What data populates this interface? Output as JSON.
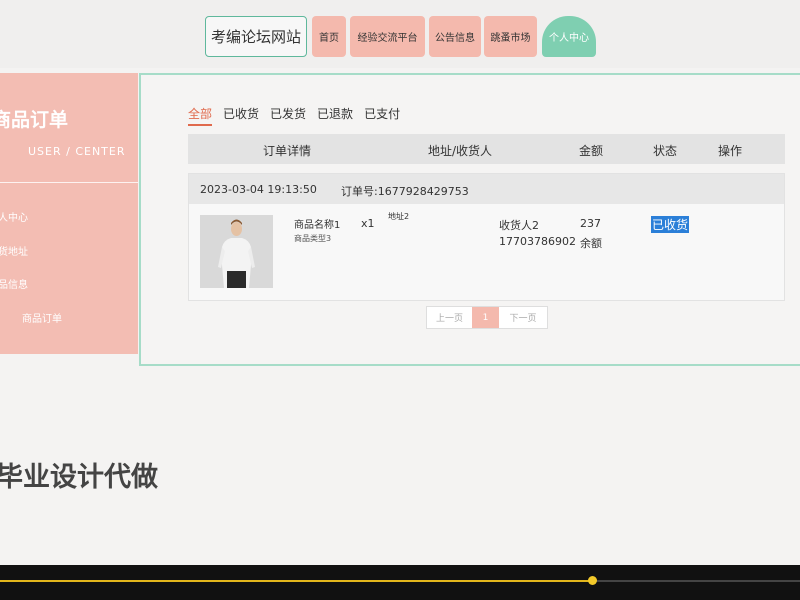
{
  "nav": {
    "site_title": "考编论坛网站",
    "items": [
      {
        "label": "首页"
      },
      {
        "label": "经验交流平台"
      },
      {
        "label": "公告信息"
      },
      {
        "label": "跳蚤市场"
      },
      {
        "label": "个人中心"
      }
    ]
  },
  "sidebar": {
    "title": "商品订单",
    "subtitle": "USER / CENTER",
    "items": [
      {
        "label": "人中心"
      },
      {
        "label": "货地址"
      },
      {
        "label": "品信息"
      },
      {
        "label": "商品订单"
      }
    ]
  },
  "tabs": [
    {
      "label": "全部"
    },
    {
      "label": "已收货"
    },
    {
      "label": "已发货"
    },
    {
      "label": "已退款"
    },
    {
      "label": "已支付"
    }
  ],
  "table": {
    "headers": [
      "订单详情",
      "地址/收货人",
      "金额",
      "状态",
      "操作"
    ]
  },
  "order": {
    "time": "2023-03-04 19:13:50",
    "order_no": "订单号:1677928429753",
    "product_name": "商品名称1",
    "product_type": "商品类型3",
    "quantity": "x1",
    "address": "地址2",
    "receiver": "收货人2",
    "phone": "17703786902",
    "amount": "237",
    "payment": "余额",
    "status": "已收货"
  },
  "pagination": {
    "prev": "上一页",
    "current": "1",
    "next": "下一页"
  },
  "promo": "毕业设计代做",
  "video": {
    "progress": 0.74
  },
  "colors": {
    "accent_pink": "#f4b9ad",
    "accent_green": "#7fcfb1",
    "status_highlight": "#2b7fd8",
    "progress": "#e2b61c"
  }
}
